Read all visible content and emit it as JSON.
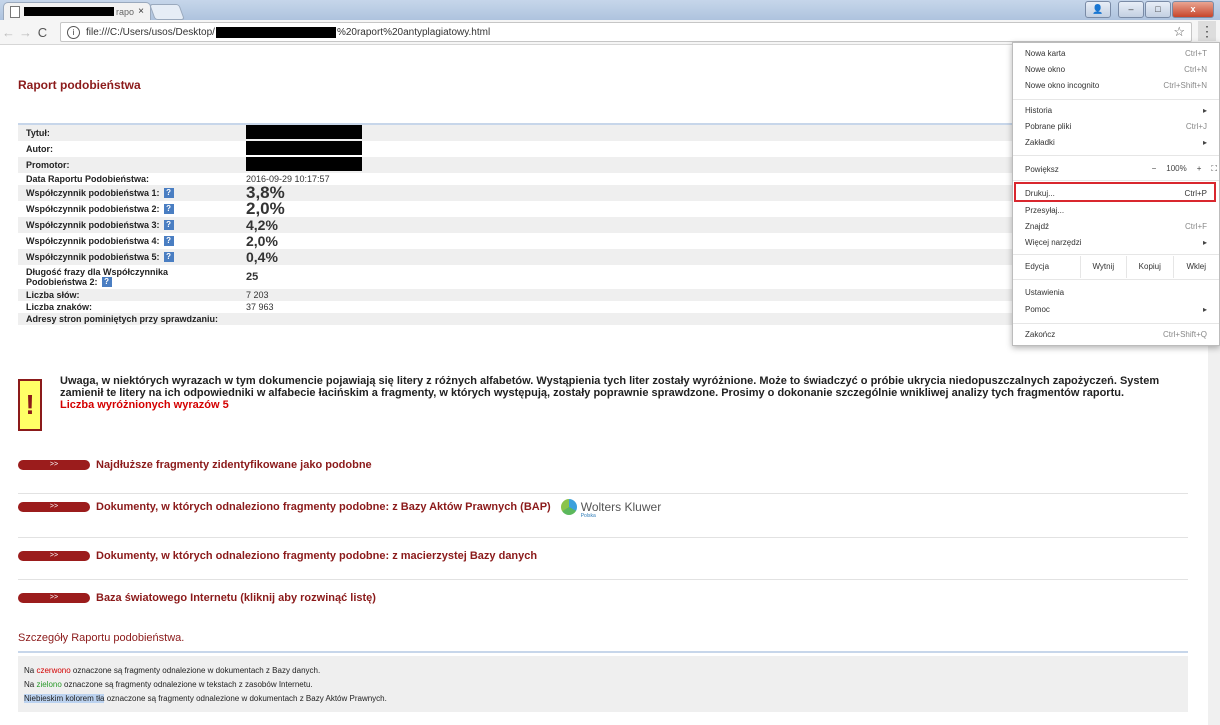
{
  "browser": {
    "tab_title": "rapo",
    "tab_close": "×",
    "url_prefix": "file:///C:/Users/usos/Desktop/",
    "url_suffix": "%20raport%20antyplagiatowy.html",
    "window_buttons": [
      "–",
      "□",
      "x"
    ]
  },
  "report": {
    "title": "Raport podobieństwa",
    "meta": [
      {
        "label": "Tytuł:",
        "value": ""
      },
      {
        "label": "Autor:",
        "value": ""
      },
      {
        "label": "Promotor:",
        "value": ""
      },
      {
        "label": "Data Raportu Podobieństwa:",
        "value": "2016-09-29 10:17:57"
      },
      {
        "label": "Współczynnik podobieństwa 1:",
        "value": "3,8%"
      },
      {
        "label": "Współczynnik podobieństwa 2:",
        "value": "2,0%"
      },
      {
        "label": "Współczynnik podobieństwa 3:",
        "value": "4,2%"
      },
      {
        "label": "Współczynnik podobieństwa 4:",
        "value": "2,0%"
      },
      {
        "label": "Współczynnik podobieństwa 5:",
        "value": "0,4%"
      },
      {
        "label": "Długość frazy dla Współczynnika Podobieństwa 2:",
        "value": "25"
      },
      {
        "label": "Liczba słów:",
        "value": "7 203"
      },
      {
        "label": "Liczba znaków:",
        "value": "37 963"
      },
      {
        "label": "Adresy stron pominiętych przy sprawdzaniu:",
        "value": ""
      }
    ],
    "help_icon": "?",
    "warning": {
      "icon": "!",
      "text": "Uwaga, w niektórych wyrazach w tym dokumencie pojawiają się litery z różnych alfabetów. Wystąpienia tych liter zostały wyróżnione. Może to świadczyć o próbie ukrycia niedopuszczalnych zapożyczeń. System zamienił te litery na ich odpowiedniki w alfabecie łacińskim a fragmenty, w których występują, zostały poprawnie sprawdzone. Prosimy o dokonanie szczególnie wnikliwej analizy tych fragmentów raportu.",
      "count": "Liczba wyróżnionych wyrazów 5"
    },
    "sections": [
      {
        "button": ">>",
        "title": "Najdłuższe fragmenty zidentyfikowane jako podobne"
      },
      {
        "button": ">>",
        "title": "Dokumenty, w których odnaleziono fragmenty podobne: z Bazy Aktów Prawnych (BAP)"
      },
      {
        "button": ">>",
        "title": "Dokumenty, w których odnaleziono fragmenty podobne: z macierzystej Bazy danych"
      },
      {
        "button": ">>",
        "title": "Baza światowego Internetu (kliknij aby rozwinąć listę)"
      }
    ],
    "partner": {
      "name": "Wolters Kluwer",
      "sub": "Polska"
    },
    "details_title": "Szczegóły Raportu podobieństwa.",
    "legend": {
      "l1a": "Na ",
      "l1b": "czerwono",
      "l1c": " oznaczone są fragmenty odnalezione w dokumentach z Bazy danych.",
      "l2a": "Na ",
      "l2b": "zielono",
      "l2c": " oznaczone są fragmenty odnalezione w tekstach z zasobów Internetu.",
      "l3a": "Niebieskim kolorem tła",
      "l3b": " oznaczone są fragmenty odnalezione w dokumentach z Bazy Aktów Prawnych."
    }
  },
  "menu": {
    "items": [
      {
        "label": "Nowa karta",
        "shortcut": "Ctrl+T"
      },
      {
        "label": "Nowe okno",
        "shortcut": "Ctrl+N"
      },
      {
        "label": "Nowe okno incognito",
        "shortcut": "Ctrl+Shift+N"
      },
      {
        "label": "Historia",
        "shortcut": "▸"
      },
      {
        "label": "Pobrane pliki",
        "shortcut": "Ctrl+J"
      },
      {
        "label": "Zakładki",
        "shortcut": "▸"
      },
      {
        "label": "Drukuj...",
        "shortcut": "Ctrl+P"
      },
      {
        "label": "Przesyłaj...",
        "shortcut": ""
      },
      {
        "label": "Znajdź",
        "shortcut": "Ctrl+F"
      },
      {
        "label": "Więcej narzędzi",
        "shortcut": "▸"
      },
      {
        "label": "Ustawienia",
        "shortcut": ""
      },
      {
        "label": "Pomoc",
        "shortcut": "▸"
      },
      {
        "label": "Zakończ",
        "shortcut": "Ctrl+Shift+Q"
      }
    ],
    "zoom": {
      "label": "Powiększ",
      "minus": "−",
      "value": "100%",
      "plus": "+",
      "fullscreen": "⛶"
    },
    "edit": {
      "label": "Edycja",
      "cut": "Wytnij",
      "copy": "Kopiuj",
      "paste": "Wklej"
    }
  },
  "colors": {
    "accent_red": "#8b1a1a",
    "highlight_border": "#d9272e",
    "orange": "#e06a15"
  }
}
